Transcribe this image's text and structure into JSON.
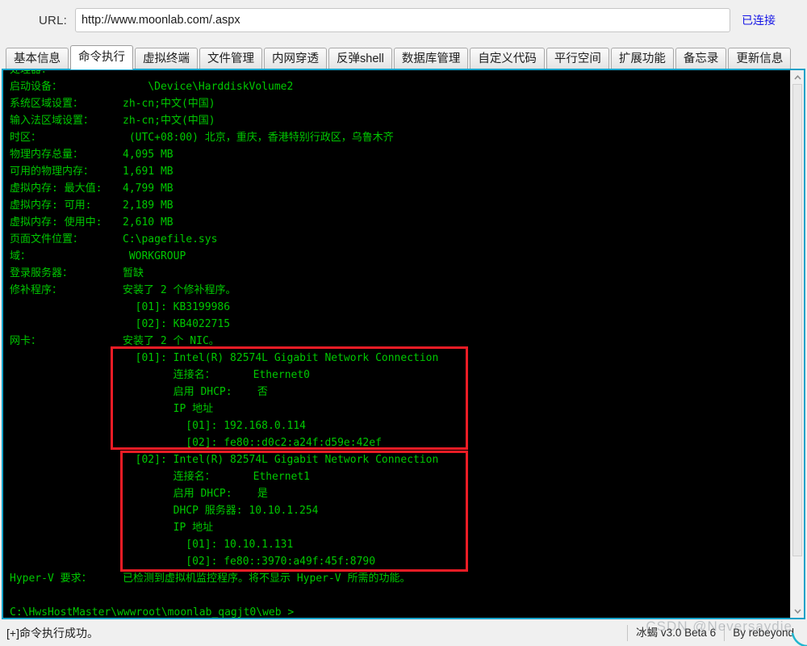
{
  "urlbar": {
    "label": "URL:",
    "value": "http://www.moonlab.com/.aspx",
    "placeholder": "http://",
    "connection_status": "已连接",
    "connection_color": "#1414e6"
  },
  "tabs": [
    {
      "label": "基本信息",
      "active": false
    },
    {
      "label": "命令执行",
      "active": true
    },
    {
      "label": "虚拟终端",
      "active": false
    },
    {
      "label": "文件管理",
      "active": false
    },
    {
      "label": "内网穿透",
      "active": false
    },
    {
      "label": "反弹shell",
      "active": false
    },
    {
      "label": "数据库管理",
      "active": false
    },
    {
      "label": "自定义代码",
      "active": false
    },
    {
      "label": "平行空间",
      "active": false
    },
    {
      "label": "扩展功能",
      "active": false
    },
    {
      "label": "备忘录",
      "active": false
    },
    {
      "label": "更新信息",
      "active": false
    }
  ],
  "terminal": {
    "text_color": "#00c800",
    "background": "#000000",
    "border_color": "#17a2c9",
    "lines": [
      {
        "label": "处理器：",
        "value": ""
      },
      {
        "label": "启动设备：",
        "value": "    \\Device\\HarddiskVolume2"
      },
      {
        "label": "系统区域设置：",
        "value": "zh-cn;中文(中国)"
      },
      {
        "label": "输入法区域设置：",
        "value": "zh-cn;中文(中国)"
      },
      {
        "label": "时区：",
        "value": " (UTC+08:00) 北京，重庆，香港特别行政区，乌鲁木齐"
      },
      {
        "label": "物理内存总量：",
        "value": "4,095 MB"
      },
      {
        "label": "可用的物理内存：",
        "value": "1,691 MB"
      },
      {
        "label": "虚拟内存: 最大值:",
        "value": "4,799 MB"
      },
      {
        "label": "虚拟内存: 可用:",
        "value": "2,189 MB"
      },
      {
        "label": "虚拟内存: 使用中:",
        "value": "2,610 MB"
      },
      {
        "label": "页面文件位置：",
        "value": "C:\\pagefile.sys"
      },
      {
        "label": "域：",
        "value": " WORKGROUP"
      },
      {
        "label": "登录服务器：",
        "value": "暂缺"
      },
      {
        "label": "修补程序：",
        "value": "安装了 2 个修补程序。"
      },
      {
        "label": "",
        "value": "  [01]: KB3199986"
      },
      {
        "label": "",
        "value": "  [02]: KB4022715"
      },
      {
        "label": "网卡：",
        "value": "安装了 2 个 NIC。"
      },
      {
        "label": "",
        "value": "  [01]: Intel(R) 82574L Gigabit Network Connection"
      },
      {
        "label": "",
        "value": "        连接名：      Ethernet0"
      },
      {
        "label": "",
        "value": "        启用 DHCP:    否"
      },
      {
        "label": "",
        "value": "        IP 地址"
      },
      {
        "label": "",
        "value": "          [01]: 192.168.0.114"
      },
      {
        "label": "",
        "value": "          [02]: fe80::d0c2:a24f:d59e:42ef"
      },
      {
        "label": "",
        "value": "  [02]: Intel(R) 82574L Gigabit Network Connection"
      },
      {
        "label": "",
        "value": "        连接名：      Ethernet1"
      },
      {
        "label": "",
        "value": "        启用 DHCP:    是"
      },
      {
        "label": "",
        "value": "        DHCP 服务器: 10.10.1.254"
      },
      {
        "label": "",
        "value": "        IP 地址"
      },
      {
        "label": "",
        "value": "          [01]: 10.10.1.131"
      },
      {
        "label": "",
        "value": "          [02]: fe80::3970:a49f:45f:8790"
      },
      {
        "label": "Hyper-V 要求：",
        "value": "已检测到虚拟机监控程序。将不显示 Hyper-V 所需的功能。"
      },
      {
        "label": "",
        "value": ""
      },
      {
        "label": "",
        "value": "C:\\HwsHostMaster\\wwwroot\\moonlab_qagjt0\\web >"
      }
    ],
    "annotations": [
      {
        "name": "nic-1-highlight",
        "color": "#ee1c25"
      },
      {
        "name": "nic-2-highlight",
        "color": "#ee1c25"
      }
    ]
  },
  "scrollbar": {
    "up_arrow": "chevron-up-icon",
    "down_arrow": "chevron-down-icon"
  },
  "statusbar": {
    "message": "[+]命令执行成功。",
    "app_version": "冰蝎 v3.0 Beta 6",
    "author": "By rebeyond"
  },
  "watermark": {
    "text": "CSDN @Neversaydie"
  }
}
